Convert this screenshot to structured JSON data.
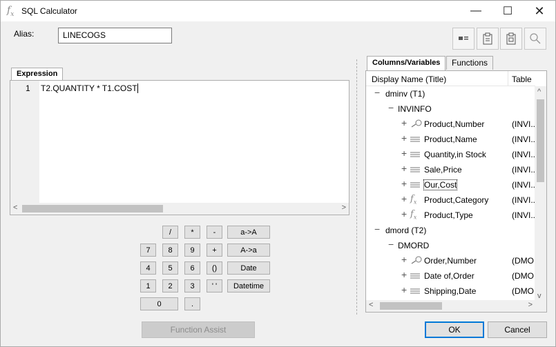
{
  "window": {
    "title": "SQL Calculator",
    "icon": "fx-icon",
    "controls": {
      "minimize": "—",
      "maximize": "☐",
      "close": "✕"
    }
  },
  "alias": {
    "label": "Alias:",
    "value": "LINECOGS"
  },
  "toolbar": {
    "icons": [
      "card-icon",
      "clipboard-icon",
      "clipboard-check-icon",
      "search-icon"
    ]
  },
  "expression": {
    "tab_label": "Expression",
    "line_number": "1",
    "code": "T2.QUANTITY * T1.COST"
  },
  "calculator": {
    "keys": [
      "/",
      "*",
      "-",
      "a->A",
      "7",
      "8",
      "9",
      "+",
      "A->a",
      "4",
      "5",
      "6",
      "()",
      "Date",
      "1",
      "2",
      "3",
      "' '",
      "Datetime",
      "0",
      "."
    ]
  },
  "buttons": {
    "function_assist": "Function Assist",
    "ok": "OK",
    "cancel": "Cancel"
  },
  "right_panel": {
    "tabs": [
      "Columns/Variables",
      "Functions"
    ],
    "columns": [
      "Display Name (Title)",
      "Table"
    ],
    "tree": [
      {
        "label": "dminv (T1)",
        "table": "",
        "icon": "",
        "level": 0,
        "expander": "−"
      },
      {
        "label": "INVINFO",
        "table": "",
        "icon": "",
        "level": 1,
        "expander": "−"
      },
      {
        "label": "Product,Number",
        "table": "(INVI...",
        "icon": "key-icon",
        "level": 2,
        "expander": "+"
      },
      {
        "label": "Product,Name",
        "table": "(INVI...",
        "icon": "field-icon",
        "level": 2,
        "expander": "+"
      },
      {
        "label": "Quantity,in Stock",
        "table": "(INVI...",
        "icon": "field-icon",
        "level": 2,
        "expander": "+"
      },
      {
        "label": "Sale,Price",
        "table": "(INVI...",
        "icon": "field-icon",
        "level": 2,
        "expander": "+"
      },
      {
        "label": "Our,Cost",
        "table": "(INVI...",
        "icon": "field-icon",
        "level": 2,
        "expander": "+"
      },
      {
        "label": "Product,Category",
        "table": "(INVI...",
        "icon": "fx-icon",
        "level": 2,
        "expander": "+"
      },
      {
        "label": "Product,Type",
        "table": "(INVI...",
        "icon": "fx-icon",
        "level": 2,
        "expander": "+"
      },
      {
        "label": "dmord (T2)",
        "table": "",
        "icon": "",
        "level": 0,
        "expander": "−"
      },
      {
        "label": "DMORD",
        "table": "",
        "icon": "",
        "level": 1,
        "expander": "−"
      },
      {
        "label": "Order,Number",
        "table": "(DMO...",
        "icon": "key-icon",
        "level": 2,
        "expander": "+"
      },
      {
        "label": "Date of,Order",
        "table": "(DMO...",
        "icon": "field-icon",
        "level": 2,
        "expander": "+"
      },
      {
        "label": "Shipping,Date",
        "table": "(DMO...",
        "icon": "field-icon",
        "level": 2,
        "expander": "+"
      }
    ]
  },
  "colors": {
    "accent": "#0078d7",
    "border": "#adadad",
    "disabled_text": "#8c8c8c"
  }
}
